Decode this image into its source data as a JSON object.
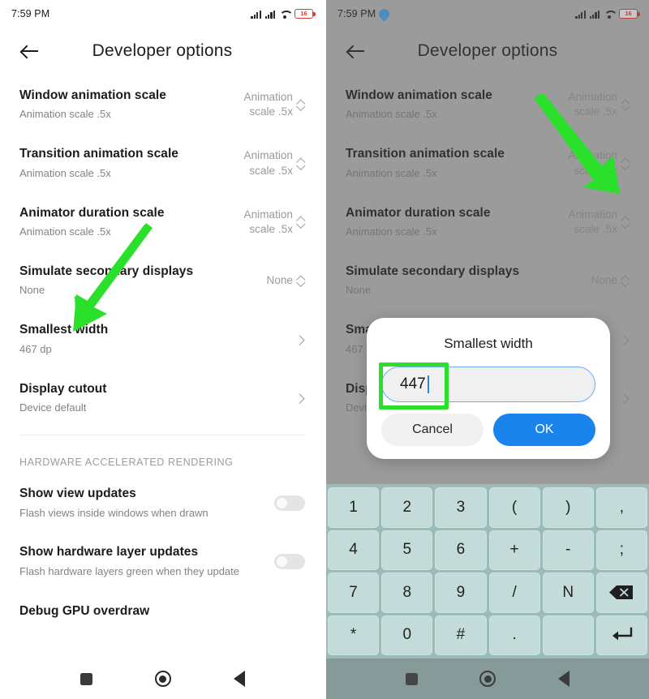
{
  "status": {
    "time": "7:59 PM",
    "battery_level": "16",
    "icons": [
      "signal-icon",
      "signal-icon",
      "wifi-icon",
      "battery-icon"
    ],
    "location_icon": "location-pin-icon"
  },
  "appbar": {
    "back_icon": "back-arrow-icon",
    "title": "Developer options"
  },
  "settings": [
    {
      "title": "Window animation scale",
      "sub": "Animation scale .5x",
      "value": "Animation scale .5x",
      "control": "stepper"
    },
    {
      "title": "Transition animation scale",
      "sub": "Animation scale .5x",
      "value": "Animation scale .5x",
      "control": "stepper"
    },
    {
      "title": "Animator duration scale",
      "sub": "Animation scale .5x",
      "value": "Animation scale .5x",
      "control": "stepper"
    },
    {
      "title": "Simulate secondary displays",
      "sub": "None",
      "value": "None",
      "control": "stepper"
    },
    {
      "title": "Smallest width",
      "sub": "467 dp",
      "value": "",
      "control": "chevron"
    },
    {
      "title": "Display cutout",
      "sub": "Device default",
      "value": "",
      "control": "chevron"
    }
  ],
  "section": {
    "header": "HARDWARE ACCELERATED RENDERING",
    "items": [
      {
        "title": "Show view updates",
        "sub": "Flash views inside windows when drawn",
        "control": "toggle",
        "on": false
      },
      {
        "title": "Show hardware layer updates",
        "sub": "Flash hardware layers green when they update",
        "control": "toggle",
        "on": false
      }
    ],
    "cut_off_item": "Debug GPU overdraw"
  },
  "navbar": {
    "recent_icon": "square-recents-icon",
    "home_icon": "circle-home-icon",
    "back_icon": "triangle-back-icon"
  },
  "dialog": {
    "title": "Smallest width",
    "input_value": "447",
    "cancel_label": "Cancel",
    "ok_label": "OK"
  },
  "keyboard": {
    "keys": [
      "1",
      "2",
      "3",
      "(",
      ")",
      ",",
      "4",
      "5",
      "6",
      "+",
      "-",
      ";",
      "7",
      "8",
      "9",
      "/",
      "N",
      "backspace-icon",
      "*",
      "0",
      "#",
      ".",
      "",
      "enter-icon"
    ]
  },
  "annotations": {
    "arrow_left_target": "Smallest width",
    "arrow_right_target": "OK",
    "highlight_target": "smallest-width-input",
    "accent_green": "#2ae02a"
  },
  "colors": {
    "ok_button": "#1a84ec",
    "input_border": "#6aaaf0",
    "battery_red": "#e03b2f",
    "keyboard_bg": "#9bbbb9",
    "key_bg": "#c3dcd9"
  }
}
